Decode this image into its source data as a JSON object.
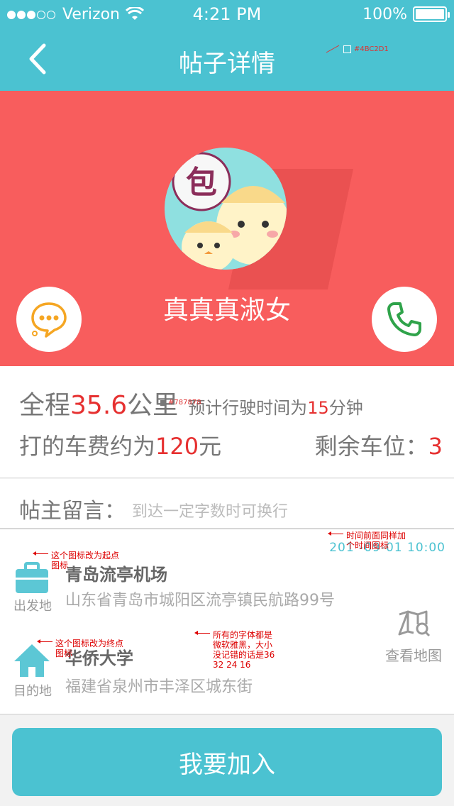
{
  "status_bar": {
    "carrier": "Verizon",
    "time": "4:21 PM",
    "battery": "100%"
  },
  "nav": {
    "title": "帖子详情",
    "color_note": "#4BC2D1"
  },
  "colors": {
    "accent": "#4BC2D1",
    "hero": "#F85D5D",
    "highlight": "#E63030",
    "text_gray": "#787878"
  },
  "profile": {
    "avatar_text": "包",
    "name": "真真真淑女",
    "chat_icon": "chat-bubble-icon",
    "phone_icon": "phone-icon"
  },
  "trip": {
    "total_prefix": "全程",
    "distance": "35.6",
    "distance_unit": "公里",
    "eta_prefix": "预计行驶时间为",
    "eta_value": "15",
    "eta_unit": "分钟",
    "fare_prefix": "打的车费约为",
    "fare_value": "120",
    "fare_unit": "元",
    "seats_label": "剩余车位：",
    "seats_value": "3",
    "gray_note": "#787878"
  },
  "message": {
    "label": "帖主留言",
    "colon": "：",
    "hint": "到达一定字数时可换行"
  },
  "route": {
    "datetime": "201 -09-01   10:00",
    "start": {
      "caption": "出发地",
      "name": "青岛流亭机场",
      "address": "山东省青岛市城阳区流亭镇民航路99号"
    },
    "end": {
      "caption": "目的地",
      "name": "华侨大学",
      "address": "福建省泉州市丰泽区城东街"
    },
    "map_label": "查看地图"
  },
  "annotations": {
    "start_icon_note": "这个图标改为起点图标",
    "end_icon_note": "这个图标改为终点图标",
    "time_icon_note": "时间前面同样加个时间图标",
    "font_note": "所有的字体都是微软雅黑，大小没记错的话是36 32 24 16"
  },
  "join_button": "我要加入"
}
